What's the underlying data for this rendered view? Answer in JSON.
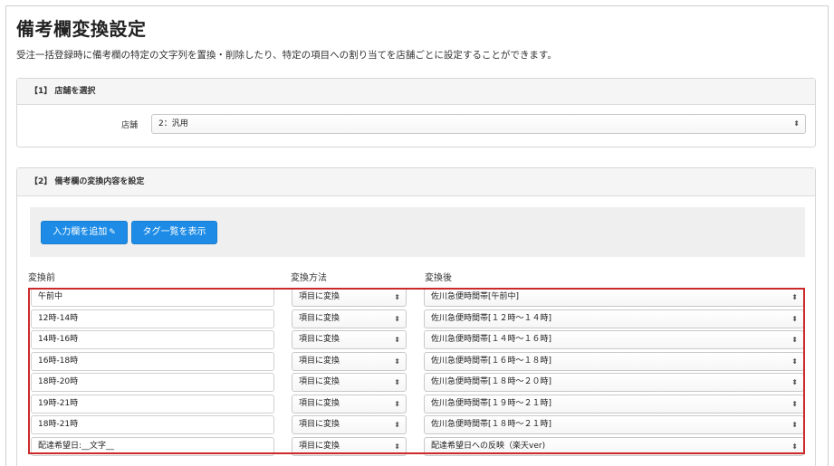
{
  "page": {
    "title": "備考欄変換設定",
    "description": "受注一括登録時に備考欄の特定の文字列を置換・削除したり、特定の項目への割り当てを店舗ごとに設定することができます。"
  },
  "section1": {
    "heading": "【1】 店舗を選択",
    "store_label": "店舗",
    "store_value": "2：汎用"
  },
  "section2": {
    "heading": "【2】 備考欄の変換内容を設定",
    "add_button": "入力欄を追加",
    "tags_button": "タグ一覧を表示",
    "columns": {
      "before": "変換前",
      "method": "変換方法",
      "after": "変換後"
    },
    "rows": [
      {
        "before": "午前中",
        "method": "項目に変換",
        "after": "佐川急便時間帯[午前中]"
      },
      {
        "before": "12時-14時",
        "method": "項目に変換",
        "after": "佐川急便時間帯[１２時〜１４時]"
      },
      {
        "before": "14時-16時",
        "method": "項目に変換",
        "after": "佐川急便時間帯[１４時〜１６時]"
      },
      {
        "before": "16時-18時",
        "method": "項目に変換",
        "after": "佐川急便時間帯[１６時〜１８時]"
      },
      {
        "before": "18時-20時",
        "method": "項目に変換",
        "after": "佐川急便時間帯[１８時〜２０時]"
      },
      {
        "before": "19時-21時",
        "method": "項目に変換",
        "after": "佐川急便時間帯[１９時〜２１時]"
      },
      {
        "before": "18時-21時",
        "method": "項目に変換",
        "after": "佐川急便時間帯[１８時〜２１時]"
      },
      {
        "before": "配達希望日:__文字__",
        "method": "項目に変換",
        "after": "配達希望日への反映（楽天ver)"
      }
    ]
  },
  "icons": {
    "select_arrows": "updown-arrows-icon",
    "wrench": "wrench-icon"
  },
  "colors": {
    "primary_button": "#1e8ce6",
    "highlight_border": "#cc2a2a"
  }
}
